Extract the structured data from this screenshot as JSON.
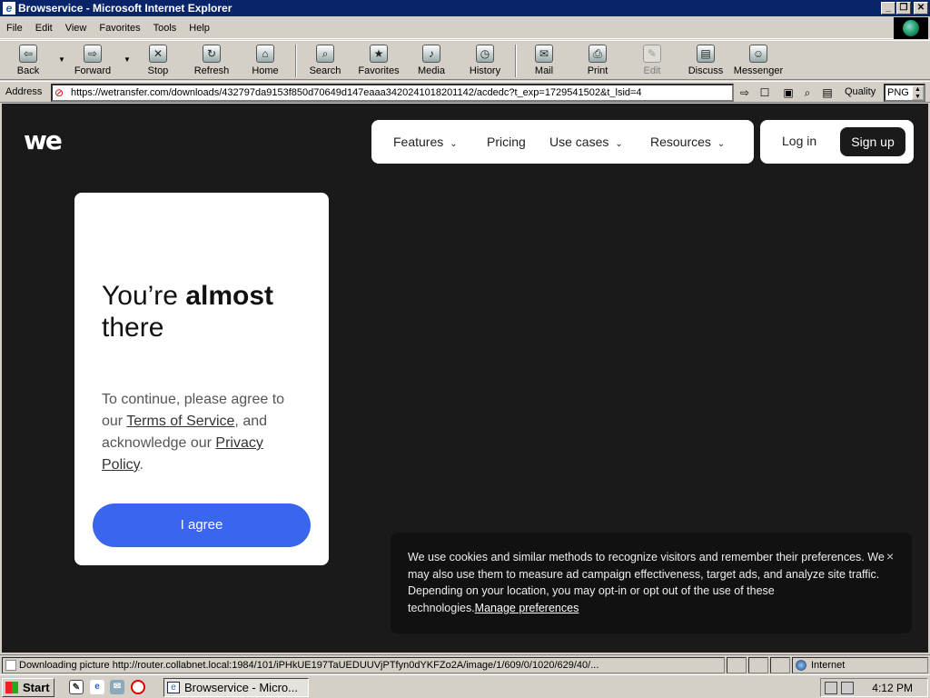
{
  "window": {
    "title": "Browservice - Microsoft Internet Explorer",
    "buttons": {
      "minimize": "_",
      "maximize": "❐",
      "close": "✕"
    }
  },
  "menu": [
    "File",
    "Edit",
    "View",
    "Favorites",
    "Tools",
    "Help"
  ],
  "toolbar": [
    {
      "label": "Back",
      "icon": "back-arrow-icon",
      "glyph": "⇦"
    },
    {
      "label": "Forward",
      "icon": "forward-arrow-icon",
      "glyph": "⇨"
    },
    {
      "label": "Stop",
      "icon": "stop-icon",
      "glyph": "✕"
    },
    {
      "label": "Refresh",
      "icon": "refresh-icon",
      "glyph": "↻"
    },
    {
      "label": "Home",
      "icon": "home-icon",
      "glyph": "⌂"
    },
    {
      "label": "Search",
      "icon": "search-icon",
      "glyph": "⌕"
    },
    {
      "label": "Favorites",
      "icon": "favorites-icon",
      "glyph": "★"
    },
    {
      "label": "Media",
      "icon": "media-icon",
      "glyph": "♪"
    },
    {
      "label": "History",
      "icon": "history-icon",
      "glyph": "◷"
    },
    {
      "label": "Mail",
      "icon": "mail-icon",
      "glyph": "✉"
    },
    {
      "label": "Print",
      "icon": "print-icon",
      "glyph": "⎙"
    },
    {
      "label": "Edit",
      "icon": "edit-icon",
      "glyph": "✎",
      "disabled": true
    },
    {
      "label": "Discuss",
      "icon": "discuss-icon",
      "glyph": "▤"
    },
    {
      "label": "Messenger",
      "icon": "messenger-icon",
      "glyph": "☺"
    }
  ],
  "address": {
    "label": "Address",
    "url": "https://wetransfer.com/downloads/432797da9153f850d70649d147eaaa3420241018201142/acdedc?t_exp=1729541502&t_lsid=4",
    "quality_label": "Quality",
    "quality_value": "PNG"
  },
  "site": {
    "logo": "we",
    "nav": [
      "Features",
      "Pricing",
      "Use cases",
      "Resources"
    ],
    "login": "Log in",
    "signup": "Sign up",
    "card": {
      "title_prefix": "You’re ",
      "title_bold": "almost",
      "title_suffix": "there",
      "body_1": "To continue, please agree to our ",
      "terms_link": "Terms of Service",
      "body_2": ", and acknowledge our ",
      "privacy_link": "Privacy Policy",
      "body_3": ".",
      "agree_button": "I agree"
    },
    "cookie": {
      "text": "We use cookies and similar methods to recognize visitors and remember their preferences. We may also use them to measure ad campaign effectiveness, target ads, and analyze site traffic. Depending on your location, you may opt-in or opt out of the use of these technologies.",
      "link": "Manage preferences",
      "close": "×"
    }
  },
  "status": {
    "text": "Downloading picture http://router.collabnet.local:1984/101/iPHkUE197TaUEDUUVjPTfyn0dYKFZo2A/image/1/609/0/1020/629/40/...",
    "zone": "Internet"
  },
  "taskbar": {
    "start": "Start",
    "task": "Browservice - Micro...",
    "clock": "4:12 PM"
  }
}
